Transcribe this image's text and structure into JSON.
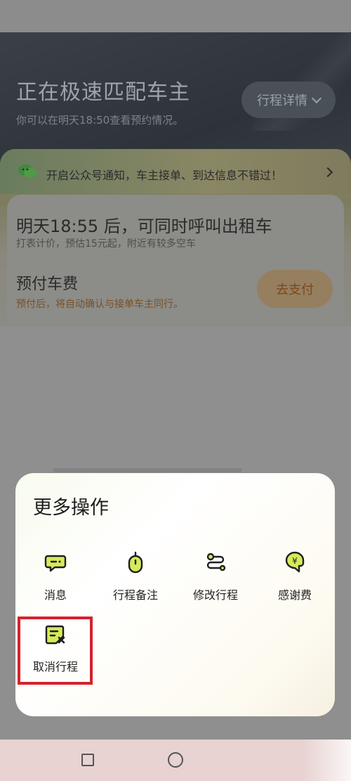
{
  "header": {
    "title": "正在极速匹配车主",
    "subtitle": "你可以在明天18:50查看预约情况。",
    "detail_button": "行程详情"
  },
  "notice": {
    "text": "开启公众号通知，车主接单、到达信息不错过！"
  },
  "taxi": {
    "title": "明天18:55 后，可同时呼叫出租车",
    "subtitle": "打表计价，预估15元起，附近有较多空车"
  },
  "prepay": {
    "title": "预付车费",
    "subtitle": "预付后，将自动确认与接单车主同行。",
    "button": "去支付"
  },
  "sheet": {
    "title": "更多操作",
    "actions": [
      {
        "label": "消息",
        "icon": "message-icon"
      },
      {
        "label": "行程备注",
        "icon": "note-icon"
      },
      {
        "label": "修改行程",
        "icon": "edit-route-icon"
      },
      {
        "label": "感谢费",
        "icon": "thanks-fee-icon"
      },
      {
        "label": "取消行程",
        "icon": "cancel-trip-icon"
      }
    ]
  },
  "colors": {
    "icon_fill": "#d6ea5a",
    "icon_stroke": "#1f1f1f",
    "highlight": "#d6212d",
    "pay_text": "#7a4a1e"
  }
}
